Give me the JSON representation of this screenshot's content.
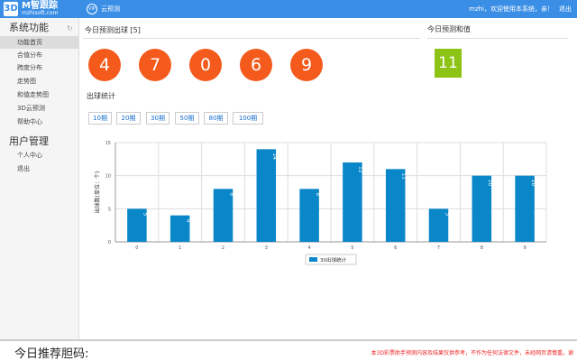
{
  "header": {
    "logo_letters": "3D",
    "logo_title": "M智跟踪",
    "logo_subtitle": "mzhisoft.com",
    "cloud_badge": "VIP",
    "cloud_label": "云预测",
    "welcome": "mzhi，欢迎使用本系统，亲！",
    "logout": "退出"
  },
  "sidebar": {
    "section1": "系统功能",
    "section1_icon": "refresh-icon",
    "items": [
      {
        "label": "功能首页",
        "active": true
      },
      {
        "label": "合值分布",
        "active": false
      },
      {
        "label": "跨度分布",
        "active": false
      },
      {
        "label": "走势图",
        "active": false
      },
      {
        "label": "和值走势图",
        "active": false
      },
      {
        "label": "3D云预测",
        "active": false
      },
      {
        "label": "帮助中心",
        "active": false
      }
    ],
    "section2": "用户管理",
    "items2": [
      {
        "label": "个人中心"
      },
      {
        "label": "退出"
      }
    ]
  },
  "main": {
    "predict_title": "今日预测出球 [5]",
    "balls": [
      "4",
      "7",
      "0",
      "6",
      "9"
    ],
    "sum_title": "今日预测和值",
    "sum_value": "11",
    "stats_title": "出球统计",
    "periods": [
      "10期",
      "20期",
      "30期",
      "50期",
      "80期",
      "100期"
    ]
  },
  "chart_data": {
    "type": "bar",
    "categories": [
      "0",
      "1",
      "2",
      "3",
      "4",
      "5",
      "6",
      "7",
      "8",
      "9"
    ],
    "series": [
      {
        "name": "30出球统计",
        "values": [
          5,
          4,
          8,
          14,
          8,
          12,
          11,
          5,
          10,
          10
        ]
      }
    ],
    "ylabel": "出球数(单位：个)",
    "ylim": [
      0,
      15
    ],
    "yticks": [
      0,
      5,
      10,
      15
    ],
    "grid": true,
    "legend": "bottom-center",
    "bar_color": "#0a87c8"
  },
  "footer": {
    "recommend_title": "今日推荐胆码:",
    "disclaimer": "本3D彩票助手预测内容及结果仅供参考，不作为任何法律文件，未经网页请慎重。谢"
  },
  "colors": {
    "topbar": "#3a8ee6",
    "ball": "#f35a1b",
    "sum": "#8cc314",
    "bar": "#0a87c8"
  }
}
